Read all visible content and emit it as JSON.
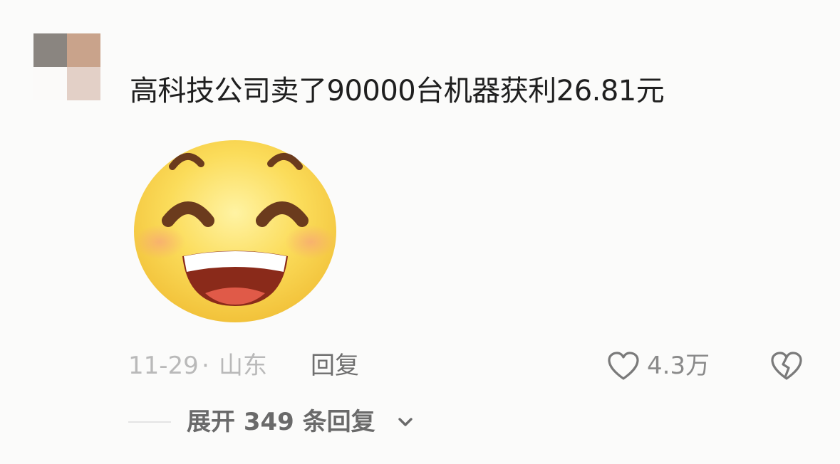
{
  "comment": {
    "text": "高科技公司卖了90000台机器获利26.81元",
    "sticker": "grinning-face-sticker"
  },
  "meta": {
    "date": "11-29",
    "separator": "·",
    "location": "山东",
    "reply_label": "回复"
  },
  "actions": {
    "like_icon": "heart-outline-icon",
    "like_count": "4.3万",
    "dislike_icon": "broken-heart-icon"
  },
  "replies": {
    "expand_label": "展开 349 条回复",
    "chevron_icon": "chevron-down-icon"
  },
  "colors": {
    "background": "#fbfbfa",
    "text_primary": "#1f1f1f",
    "text_muted": "#b9b9b9",
    "text_secondary": "#6e6e6e"
  }
}
